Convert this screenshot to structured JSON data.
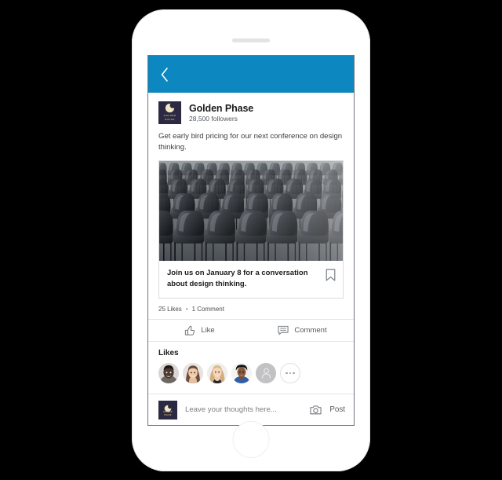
{
  "device": {
    "frame_color": "#ffffff",
    "background_color": "#000000"
  },
  "app": {
    "header": {
      "background_color": "#0c87c0",
      "back_icon": "chevron-left-icon"
    }
  },
  "post": {
    "author": {
      "name": "Golden Phase",
      "followers": "28,500 followers",
      "logo": {
        "icon": "crescent-moon-icon",
        "line1": "GOLDEN",
        "line2": "PHASE",
        "background_color": "#2b2a42",
        "text_color": "#c7a96b"
      }
    },
    "body_text": "Get early bird pricing for our next conference on design thinking.",
    "article": {
      "image_alt": "rows of empty black conference chairs",
      "caption": "Join us on January 8 for a conversation about design thinking.",
      "bookmark_icon": "bookmark-icon"
    },
    "counts": {
      "likes": "25 Likes",
      "separator": "•",
      "comments": "1 Comment"
    },
    "actions": [
      {
        "label": "Like",
        "icon": "thumbs-up-icon"
      },
      {
        "label": "Comment",
        "icon": "comment-bubble-icon"
      }
    ]
  },
  "likes_section": {
    "title": "Likes",
    "avatars": [
      {
        "name": "liker-avatar-1"
      },
      {
        "name": "liker-avatar-2"
      },
      {
        "name": "liker-avatar-3"
      },
      {
        "name": "liker-avatar-4"
      }
    ],
    "placeholder_avatar": "person-silhouette-icon",
    "more_button": "more-likes-button"
  },
  "composer": {
    "placeholder": "Leave your thoughts here...",
    "camera_icon": "camera-icon",
    "post_label": "Post"
  }
}
